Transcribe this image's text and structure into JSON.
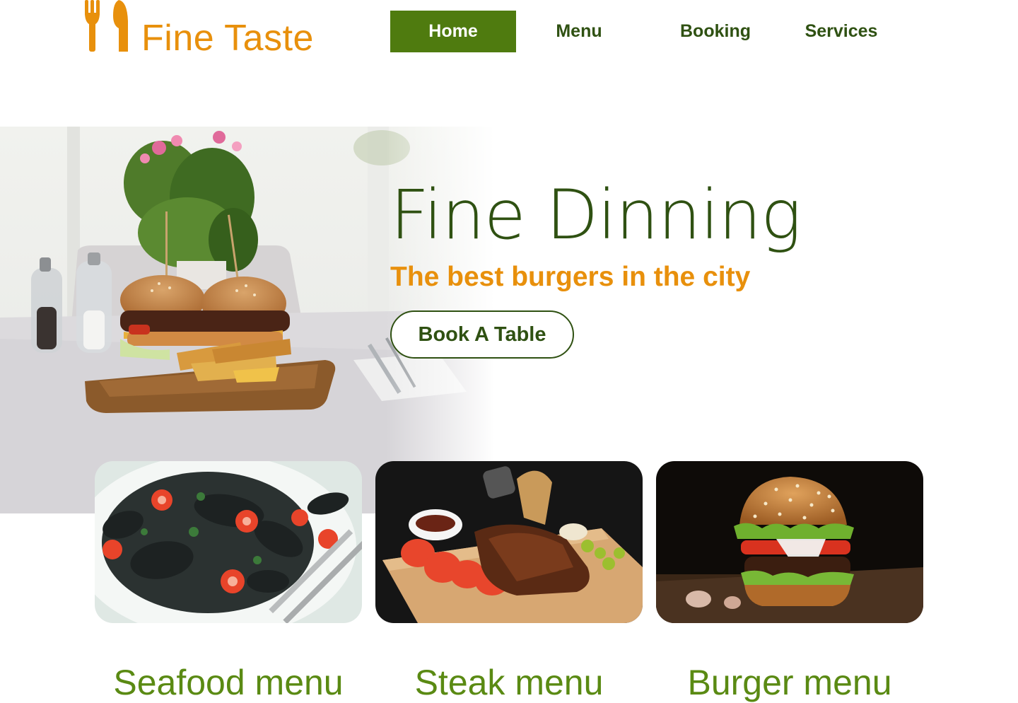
{
  "brand": {
    "name": "Fine Taste",
    "icon": "fork-knife-icon",
    "color": "#e8900c"
  },
  "nav": {
    "items": [
      {
        "label": "Home",
        "active": true
      },
      {
        "label": "Menu",
        "active": false
      },
      {
        "label": "Booking",
        "active": false
      },
      {
        "label": "Services",
        "active": false
      }
    ],
    "active_color": "#4f7b0f",
    "text_color": "#2f5112"
  },
  "hero": {
    "title": "Fine Dinning",
    "subtitle": "The best burgers in the city",
    "cta_label": "Book A Table",
    "image": "burger-on-table-photo"
  },
  "menus": [
    {
      "title": "Seafood menu",
      "image": "mussels-pasta-photo"
    },
    {
      "title": "Steak menu",
      "image": "ribs-board-photo"
    },
    {
      "title": "Burger menu",
      "image": "cheeseburger-photo"
    }
  ],
  "colors": {
    "accent": "#e8900c",
    "primary": "#4f7b0f",
    "dark_green": "#2f5112",
    "light_green": "#5a8a13"
  }
}
